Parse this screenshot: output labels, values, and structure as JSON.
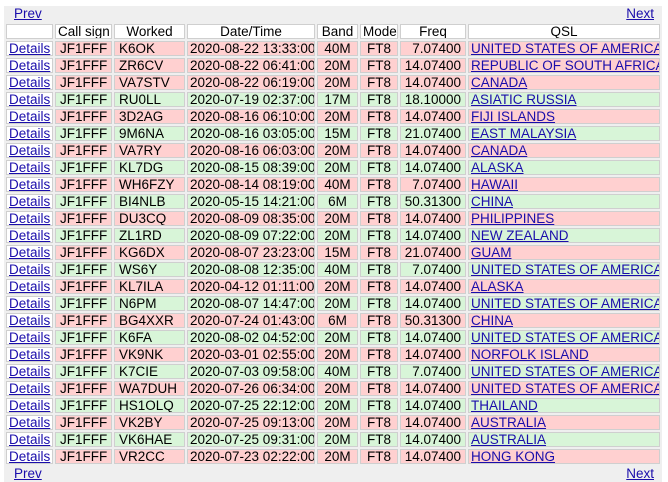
{
  "nav": {
    "prev_label": "Prev",
    "next_label": "Next"
  },
  "headers": {
    "details": "",
    "call_sign": "Call sign",
    "worked": "Worked",
    "datetime": "Date/Time",
    "band": "Band",
    "mode": "Mode",
    "freq": "Freq",
    "qsl": "QSL"
  },
  "colors": {
    "red_row": "#ffd0d0",
    "green_row": "#d8f5d8",
    "link": "#1a0dab"
  },
  "rows": [
    {
      "details": "Details",
      "call": "JF1FFF",
      "worked": "K6OK",
      "datetime": "2020-08-22 13:33:00",
      "band": "40M",
      "mode": "FT8",
      "freq": "7.07400",
      "qsl": "UNITED STATES OF AMERICA",
      "tone": "red"
    },
    {
      "details": "Details",
      "call": "JF1FFF",
      "worked": "ZR6CV",
      "datetime": "2020-08-22 06:41:00",
      "band": "20M",
      "mode": "FT8",
      "freq": "14.07400",
      "qsl": "REPUBLIC OF SOUTH AFRICA",
      "tone": "red"
    },
    {
      "details": "Details",
      "call": "JF1FFF",
      "worked": "VA7STV",
      "datetime": "2020-08-22 06:19:00",
      "band": "20M",
      "mode": "FT8",
      "freq": "14.07400",
      "qsl": "CANADA",
      "tone": "red"
    },
    {
      "details": "Details",
      "call": "JF1FFF",
      "worked": "RU0LL",
      "datetime": "2020-07-19 02:37:00",
      "band": "17M",
      "mode": "FT8",
      "freq": "18.10000",
      "qsl": "ASIATIC RUSSIA",
      "tone": "green"
    },
    {
      "details": "Details",
      "call": "JF1FFF",
      "worked": "3D2AG",
      "datetime": "2020-08-16 06:10:00",
      "band": "20M",
      "mode": "FT8",
      "freq": "14.07400",
      "qsl": "FIJI ISLANDS",
      "tone": "red"
    },
    {
      "details": "Details",
      "call": "JF1FFF",
      "worked": "9M6NA",
      "datetime": "2020-08-16 03:05:00",
      "band": "15M",
      "mode": "FT8",
      "freq": "21.07400",
      "qsl": "EAST MALAYSIA",
      "tone": "green"
    },
    {
      "details": "Details",
      "call": "JF1FFF",
      "worked": "VA7RY",
      "datetime": "2020-08-16 06:03:00",
      "band": "20M",
      "mode": "FT8",
      "freq": "14.07400",
      "qsl": "CANADA",
      "tone": "red"
    },
    {
      "details": "Details",
      "call": "JF1FFF",
      "worked": "KL7DG",
      "datetime": "2020-08-15 08:39:00",
      "band": "20M",
      "mode": "FT8",
      "freq": "14.07400",
      "qsl": "ALASKA",
      "tone": "green"
    },
    {
      "details": "Details",
      "call": "JF1FFF",
      "worked": "WH6FZY",
      "datetime": "2020-08-14 08:19:00",
      "band": "40M",
      "mode": "FT8",
      "freq": "7.07400",
      "qsl": "HAWAII",
      "tone": "red"
    },
    {
      "details": "Details",
      "call": "JF1FFF",
      "worked": "BI4NLB",
      "datetime": "2020-05-15 14:21:00",
      "band": "6M",
      "mode": "FT8",
      "freq": "50.31300",
      "qsl": "CHINA",
      "tone": "green"
    },
    {
      "details": "Details",
      "call": "JF1FFF",
      "worked": "DU3CQ",
      "datetime": "2020-08-09 08:35:00",
      "band": "20M",
      "mode": "FT8",
      "freq": "14.07400",
      "qsl": "PHILIPPINES",
      "tone": "red"
    },
    {
      "details": "Details",
      "call": "JF1FFF",
      "worked": "ZL1RD",
      "datetime": "2020-08-09 07:22:00",
      "band": "20M",
      "mode": "FT8",
      "freq": "14.07400",
      "qsl": "NEW ZEALAND",
      "tone": "green"
    },
    {
      "details": "Details",
      "call": "JF1FFF",
      "worked": "KG6DX",
      "datetime": "2020-08-07 23:23:00",
      "band": "15M",
      "mode": "FT8",
      "freq": "21.07400",
      "qsl": "GUAM",
      "tone": "red"
    },
    {
      "details": "Details",
      "call": "JF1FFF",
      "worked": "WS6Y",
      "datetime": "2020-08-08 12:35:00",
      "band": "40M",
      "mode": "FT8",
      "freq": "7.07400",
      "qsl": "UNITED STATES OF AMERICA",
      "tone": "green"
    },
    {
      "details": "Details",
      "call": "JF1FFF",
      "worked": "KL7ILA",
      "datetime": "2020-04-12 01:11:00",
      "band": "20M",
      "mode": "FT8",
      "freq": "14.07400",
      "qsl": "ALASKA",
      "tone": "red"
    },
    {
      "details": "Details",
      "call": "JF1FFF",
      "worked": "N6PM",
      "datetime": "2020-08-07 14:47:00",
      "band": "20M",
      "mode": "FT8",
      "freq": "14.07400",
      "qsl": "UNITED STATES OF AMERICA",
      "tone": "green"
    },
    {
      "details": "Details",
      "call": "JF1FFF",
      "worked": "BG4XXR",
      "datetime": "2020-07-24 01:43:00",
      "band": "6M",
      "mode": "FT8",
      "freq": "50.31300",
      "qsl": "CHINA",
      "tone": "red"
    },
    {
      "details": "Details",
      "call": "JF1FFF",
      "worked": "K6FA",
      "datetime": "2020-08-02 04:52:00",
      "band": "20M",
      "mode": "FT8",
      "freq": "14.07400",
      "qsl": "UNITED STATES OF AMERICA",
      "tone": "green"
    },
    {
      "details": "Details",
      "call": "JF1FFF",
      "worked": "VK9NK",
      "datetime": "2020-03-01 02:55:00",
      "band": "20M",
      "mode": "FT8",
      "freq": "14.07400",
      "qsl": "NORFOLK ISLAND",
      "tone": "red"
    },
    {
      "details": "Details",
      "call": "JF1FFF",
      "worked": "K7CIE",
      "datetime": "2020-07-03 09:58:00",
      "band": "40M",
      "mode": "FT8",
      "freq": "7.07400",
      "qsl": "UNITED STATES OF AMERICA",
      "tone": "green"
    },
    {
      "details": "Details",
      "call": "JF1FFF",
      "worked": "WA7DUH",
      "datetime": "2020-07-26 06:34:00",
      "band": "20M",
      "mode": "FT8",
      "freq": "14.07400",
      "qsl": "UNITED STATES OF AMERICA",
      "tone": "red"
    },
    {
      "details": "Details",
      "call": "JF1FFF",
      "worked": "HS1OLQ",
      "datetime": "2020-07-25 22:12:00",
      "band": "20M",
      "mode": "FT8",
      "freq": "14.07400",
      "qsl": "THAILAND",
      "tone": "green"
    },
    {
      "details": "Details",
      "call": "JF1FFF",
      "worked": "VK2BY",
      "datetime": "2020-07-25 09:13:00",
      "band": "20M",
      "mode": "FT8",
      "freq": "14.07400",
      "qsl": "AUSTRALIA",
      "tone": "red"
    },
    {
      "details": "Details",
      "call": "JF1FFF",
      "worked": "VK6HAE",
      "datetime": "2020-07-25 09:31:00",
      "band": "20M",
      "mode": "FT8",
      "freq": "14.07400",
      "qsl": "AUSTRALIA",
      "tone": "green"
    },
    {
      "details": "Details",
      "call": "JF1FFF",
      "worked": "VR2CC",
      "datetime": "2020-07-23 02:22:00",
      "band": "20M",
      "mode": "FT8",
      "freq": "14.07400",
      "qsl": "HONG KONG",
      "tone": "red"
    }
  ]
}
